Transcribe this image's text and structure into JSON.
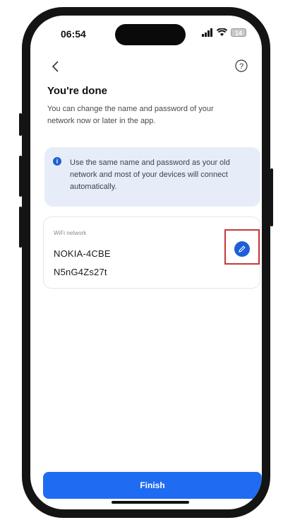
{
  "status_bar": {
    "time": "06:54",
    "battery_level": "14"
  },
  "header": {
    "title": "You're done",
    "subtitle": "You can change the name and password of your network now or later in the app."
  },
  "info_card": {
    "text": "Use the same name and password as your old network and most of your devices will connect automatically."
  },
  "wifi_card": {
    "label": "WiFi network",
    "name": "NOKIA-4CBE",
    "password": "N5nG4Zs27t"
  },
  "actions": {
    "finish_label": "Finish"
  },
  "icons": [
    "back-arrow-icon",
    "help-icon",
    "info-icon",
    "edit-pencil-icon",
    "signal-icon",
    "wifi-icon",
    "battery-icon"
  ],
  "colors": {
    "accent": "#1f6cf2",
    "info_background": "#e7edf8",
    "highlight_border": "#c8383c"
  }
}
